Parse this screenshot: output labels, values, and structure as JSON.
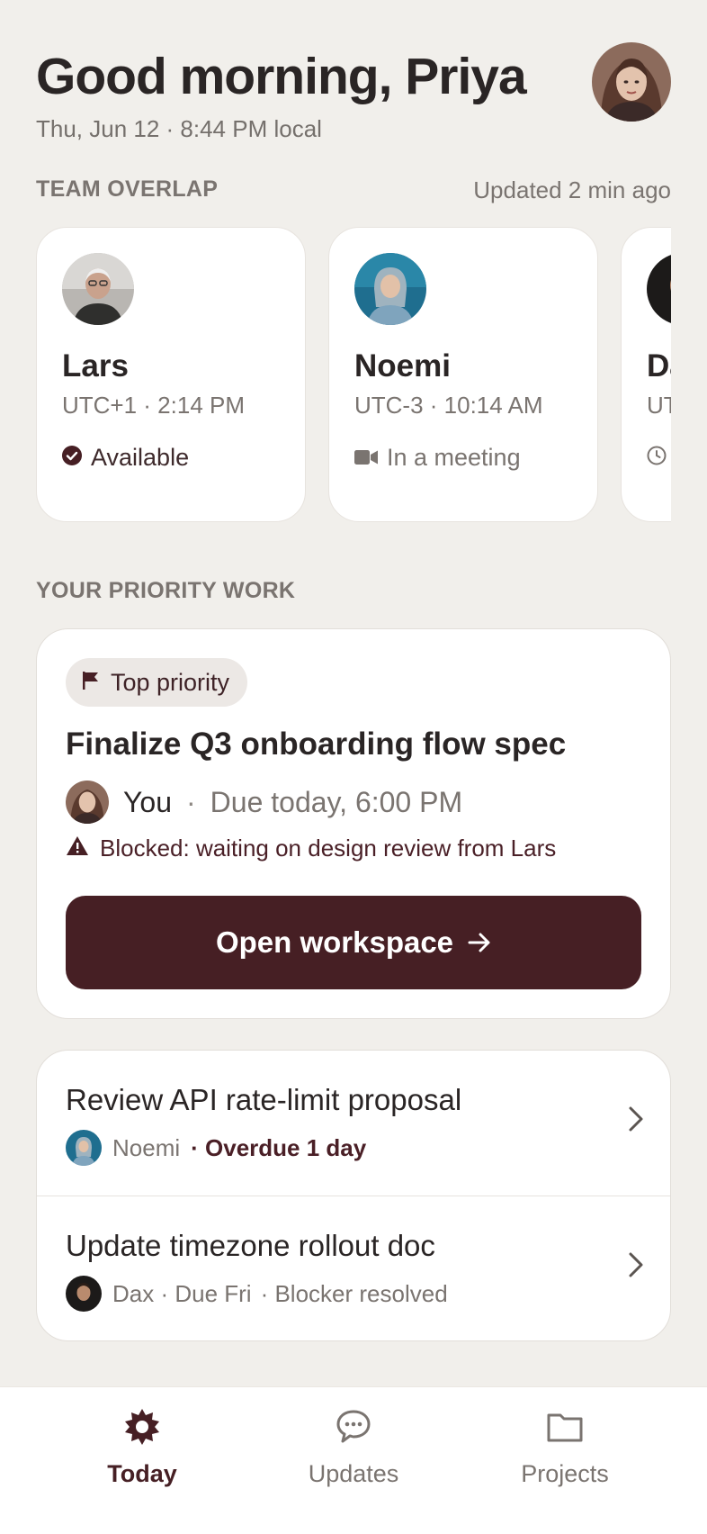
{
  "header": {
    "greeting": "Good morning, Priya",
    "date_line": "Thu, Jun 12 · 8:44 PM local",
    "avatar_name": "Priya"
  },
  "team": {
    "section_label": "TEAM OVERLAP",
    "updated": "Updated 2 min ago",
    "members": [
      {
        "name": "Lars",
        "time": "UTC+1 · 2:14 PM",
        "status": "Available",
        "status_icon": "check-circle-icon"
      },
      {
        "name": "Noemi",
        "time": "UTC-3 · 10:14 AM",
        "status": "In a meeting",
        "status_icon": "video-icon"
      },
      {
        "name": "Da",
        "time": "UT",
        "status": "",
        "status_icon": "clock-icon"
      }
    ]
  },
  "priority": {
    "section_label": "YOUR PRIORITY WORK",
    "chip": "Top priority",
    "title": "Finalize Q3 onboarding flow spec",
    "owner": "You",
    "separator": "·",
    "due": "Due today, 6:00 PM",
    "blocked": "Blocked: waiting on design review from Lars",
    "cta": "Open workspace"
  },
  "tasks": [
    {
      "title": "Review API rate-limit proposal",
      "owner": "Noemi",
      "status": "· Overdue 1 day"
    },
    {
      "title": "Update timezone rollout doc",
      "owner": "Dax · Due Fri",
      "status": "· Blocker resolved"
    }
  ],
  "nav": {
    "items": [
      {
        "label": "Today",
        "icon": "sun-icon",
        "active": true
      },
      {
        "label": "Updates",
        "icon": "chat-bubble-icon",
        "active": false
      },
      {
        "label": "Projects",
        "icon": "folder-icon",
        "active": false
      }
    ]
  },
  "colors": {
    "background": "#f1efeb",
    "accent": "#461f24",
    "text": "#2a2525",
    "muted": "#7a7470"
  }
}
